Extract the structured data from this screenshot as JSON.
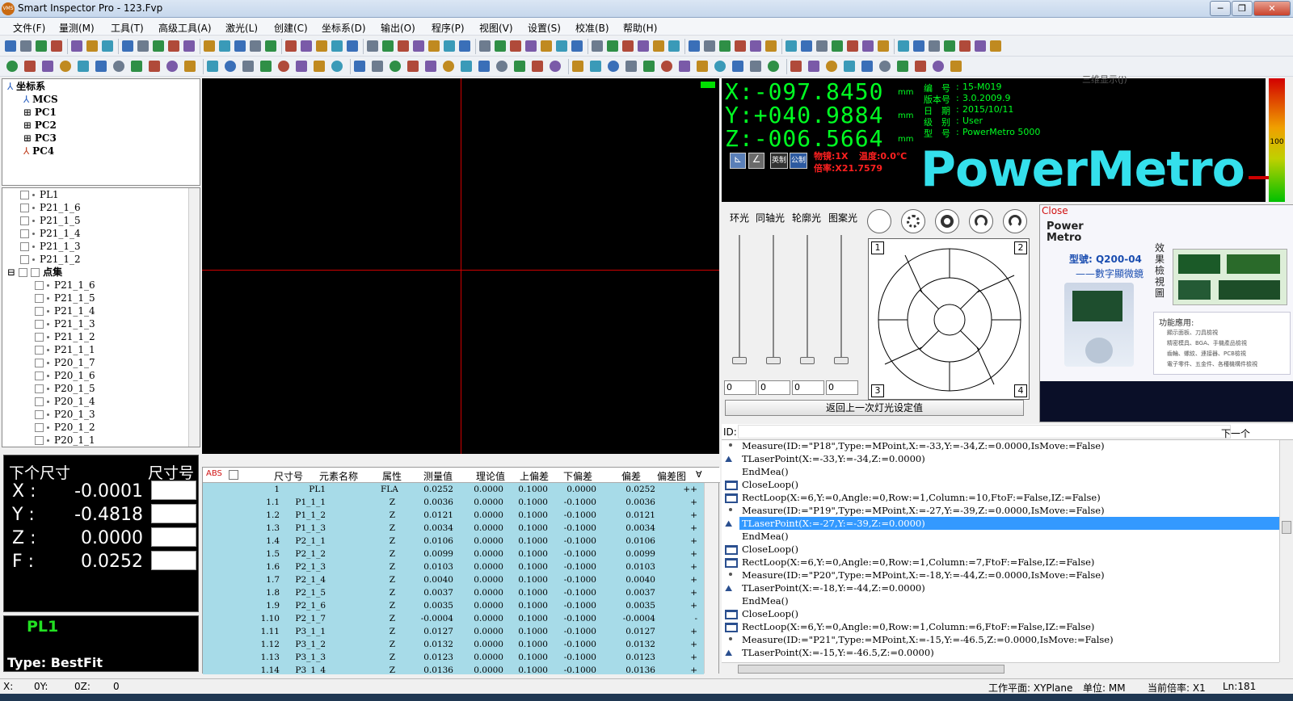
{
  "window": {
    "title": "Smart Inspector Pro - 123.Fvp",
    "icon_text": "VMS",
    "controls": [
      "─",
      "❐",
      "✕"
    ]
  },
  "menu": [
    "文件(F)",
    "量测(M)",
    "工具(T)",
    "高级工具(A)",
    "激光(L)",
    "创建(C)",
    "坐标系(D)",
    "输出(O)",
    "程序(P)",
    "视图(V)",
    "设置(S)",
    "校准(B)",
    "帮助(H)"
  ],
  "coord_tree": {
    "root": "坐标系",
    "items": [
      "MCS",
      "PC1",
      "PC2",
      "PC3",
      "PC4"
    ]
  },
  "feature_tree": {
    "items": [
      "PL1",
      "P21_1_6",
      "P21_1_5",
      "P21_1_4",
      "P21_1_3",
      "P21_1_2"
    ],
    "group": "点集",
    "children": [
      "P21_1_6",
      "P21_1_5",
      "P21_1_4",
      "P21_1_3",
      "P21_1_2",
      "P21_1_1",
      "P20_1_7",
      "P20_1_6",
      "P20_1_5",
      "P20_1_4",
      "P20_1_3",
      "P20_1_2",
      "P20_1_1"
    ]
  },
  "next_size": {
    "title": "下个尺寸",
    "col_title": "尺寸号",
    "rows": [
      {
        "label": "X :",
        "value": "-0.0001"
      },
      {
        "label": "Y :",
        "value": "-0.4818"
      },
      {
        "label": "Z :",
        "value": "0.0000"
      },
      {
        "label": "F :",
        "value": "0.0252"
      }
    ]
  },
  "element_info": {
    "name": "PL1",
    "type": "Type: BestFit"
  },
  "results": {
    "abs_label": "ABS",
    "headers": [
      "尺寸号",
      "元素名称",
      "属性",
      "测量值",
      "理论值",
      "上偏差",
      "下偏差",
      "偏差",
      "偏差图"
    ],
    "rows": [
      [
        "1",
        "PL1",
        "FLA",
        "0.0252",
        "0.0000",
        "0.1000",
        "0.0000",
        "0.0252",
        "++"
      ],
      [
        "1.1",
        "P1_1_1",
        "Z",
        "0.0036",
        "0.0000",
        "0.1000",
        "-0.1000",
        "0.0036",
        "+"
      ],
      [
        "1.2",
        "P1_1_2",
        "Z",
        "0.0121",
        "0.0000",
        "0.1000",
        "-0.1000",
        "0.0121",
        "+"
      ],
      [
        "1.3",
        "P1_1_3",
        "Z",
        "0.0034",
        "0.0000",
        "0.1000",
        "-0.1000",
        "0.0034",
        "+"
      ],
      [
        "1.4",
        "P2_1_1",
        "Z",
        "0.0106",
        "0.0000",
        "0.1000",
        "-0.1000",
        "0.0106",
        "+"
      ],
      [
        "1.5",
        "P2_1_2",
        "Z",
        "0.0099",
        "0.0000",
        "0.1000",
        "-0.1000",
        "0.0099",
        "+"
      ],
      [
        "1.6",
        "P2_1_3",
        "Z",
        "0.0103",
        "0.0000",
        "0.1000",
        "-0.1000",
        "0.0103",
        "+"
      ],
      [
        "1.7",
        "P2_1_4",
        "Z",
        "0.0040",
        "0.0000",
        "0.1000",
        "-0.1000",
        "0.0040",
        "+"
      ],
      [
        "1.8",
        "P2_1_5",
        "Z",
        "0.0037",
        "0.0000",
        "0.1000",
        "-0.1000",
        "0.0037",
        "+"
      ],
      [
        "1.9",
        "P2_1_6",
        "Z",
        "0.0035",
        "0.0000",
        "0.1000",
        "-0.1000",
        "0.0035",
        "+"
      ],
      [
        "1.10",
        "P2_1_7",
        "Z",
        "-0.0004",
        "0.0000",
        "0.1000",
        "-0.1000",
        "-0.0004",
        "-"
      ],
      [
        "1.11",
        "P3_1_1",
        "Z",
        "0.0127",
        "0.0000",
        "0.1000",
        "-0.1000",
        "0.0127",
        "+"
      ],
      [
        "1.12",
        "P3_1_2",
        "Z",
        "0.0132",
        "0.0000",
        "0.1000",
        "-0.1000",
        "0.0132",
        "+"
      ],
      [
        "1.13",
        "P3_1_3",
        "Z",
        "0.0123",
        "0.0000",
        "0.1000",
        "-0.1000",
        "0.0123",
        "+"
      ],
      [
        "1.14",
        "P3_1_4",
        "Z",
        "0.0136",
        "0.0000",
        "0.1000",
        "-0.1000",
        "0.0136",
        "+"
      ]
    ]
  },
  "dro": {
    "x": "X:-097.8450",
    "y": "Y:+040.9884",
    "z": "Z:-006.5664",
    "unit": "mm",
    "btns": [
      "英制",
      "公制"
    ],
    "mag": "物镜:1X",
    "temp": "温度:0.0℃",
    "ratio": "倍率:X21.7579"
  },
  "device": {
    "rows": [
      {
        "k": "编　号",
        "v": "15-M019"
      },
      {
        "k": "版本号",
        "v": "3.0.2009.9"
      },
      {
        "k": "日　期",
        "v": "2015/10/11"
      },
      {
        "k": "级　别",
        "v": "User"
      },
      {
        "k": "型　号",
        "v": "PowerMetro 5000"
      }
    ],
    "faded": "三维显示(J)",
    "logo": "PowerMetro",
    "bar_value": "100"
  },
  "light": {
    "labels": [
      "环光",
      "同轴光",
      "轮廓光",
      "图案光"
    ],
    "spins": [
      "0",
      "0",
      "0",
      "0"
    ],
    "quadrants": [
      "1",
      "2",
      "3",
      "4"
    ],
    "restore": "返回上一次灯光设定值"
  },
  "ad": {
    "close": "Close",
    "brand": "Power Metro",
    "model": "型號: Q200-04",
    "sub": "——數字顯微鏡",
    "side": "效果檢視圖",
    "func_title": "功能應用:",
    "funcs": [
      "顯示面板、刀具檢視",
      "精密模具、BGA、手機產品檢視",
      "齒輪、螺紋、連接器、PCB檢視",
      "電子零件、五金件、各種機構件檢視"
    ]
  },
  "program": {
    "id_label": "ID:",
    "next": "下一个",
    "lines": [
      {
        "t": "Measure(ID:=\"P18\",Type:=MPoint,X:=-33,Y:=-34,Z:=0.0000,IsMove:=False)",
        "icon": "dot"
      },
      {
        "t": "TLaserPoint(X:=-33,Y:=-34,Z:=0.0000)",
        "icon": "laser"
      },
      {
        "t": "EndMea()",
        "icon": ""
      },
      {
        "t": "CloseLoop()",
        "icon": "loop"
      },
      {
        "t": "RectLoop(X:=6,Y:=0,Angle:=0,Row:=1,Column:=10,FtoF:=False,IZ:=False)",
        "icon": "loop"
      },
      {
        "t": "Measure(ID:=\"P19\",Type:=MPoint,X:=-27,Y:=-39,Z:=0.0000,IsMove:=False)",
        "icon": "dot"
      },
      {
        "t": "TLaserPoint(X:=-27,Y:=-39,Z:=0.0000)",
        "icon": "laser",
        "sel": true
      },
      {
        "t": "EndMea()",
        "icon": ""
      },
      {
        "t": "CloseLoop()",
        "icon": "loop"
      },
      {
        "t": "RectLoop(X:=6,Y:=0,Angle:=0,Row:=1,Column:=7,FtoF:=False,IZ:=False)",
        "icon": "loop"
      },
      {
        "t": "Measure(ID:=\"P20\",Type:=MPoint,X:=-18,Y:=-44,Z:=0.0000,IsMove:=False)",
        "icon": "dot"
      },
      {
        "t": "TLaserPoint(X:=-18,Y:=-44,Z:=0.0000)",
        "icon": "laser"
      },
      {
        "t": "EndMea()",
        "icon": ""
      },
      {
        "t": "CloseLoop()",
        "icon": "loop"
      },
      {
        "t": "RectLoop(X:=6,Y:=0,Angle:=0,Row:=1,Column:=6,FtoF:=False,IZ:=False)",
        "icon": "loop"
      },
      {
        "t": "Measure(ID:=\"P21\",Type:=MPoint,X:=-15,Y:=-46.5,Z:=0.0000,IsMove:=False)",
        "icon": "dot"
      },
      {
        "t": "TLaserPoint(X:=-15,Y:=-46.5,Z:=0.0000)",
        "icon": "laser"
      }
    ]
  },
  "status": {
    "left": [
      "X:",
      "0Y:",
      "0Z:",
      "0"
    ],
    "workplane": "工作平面: XYPlane",
    "unit": "单位:  MM",
    "ratio": "当前倍率:  X1",
    "line": "Ln:181"
  }
}
